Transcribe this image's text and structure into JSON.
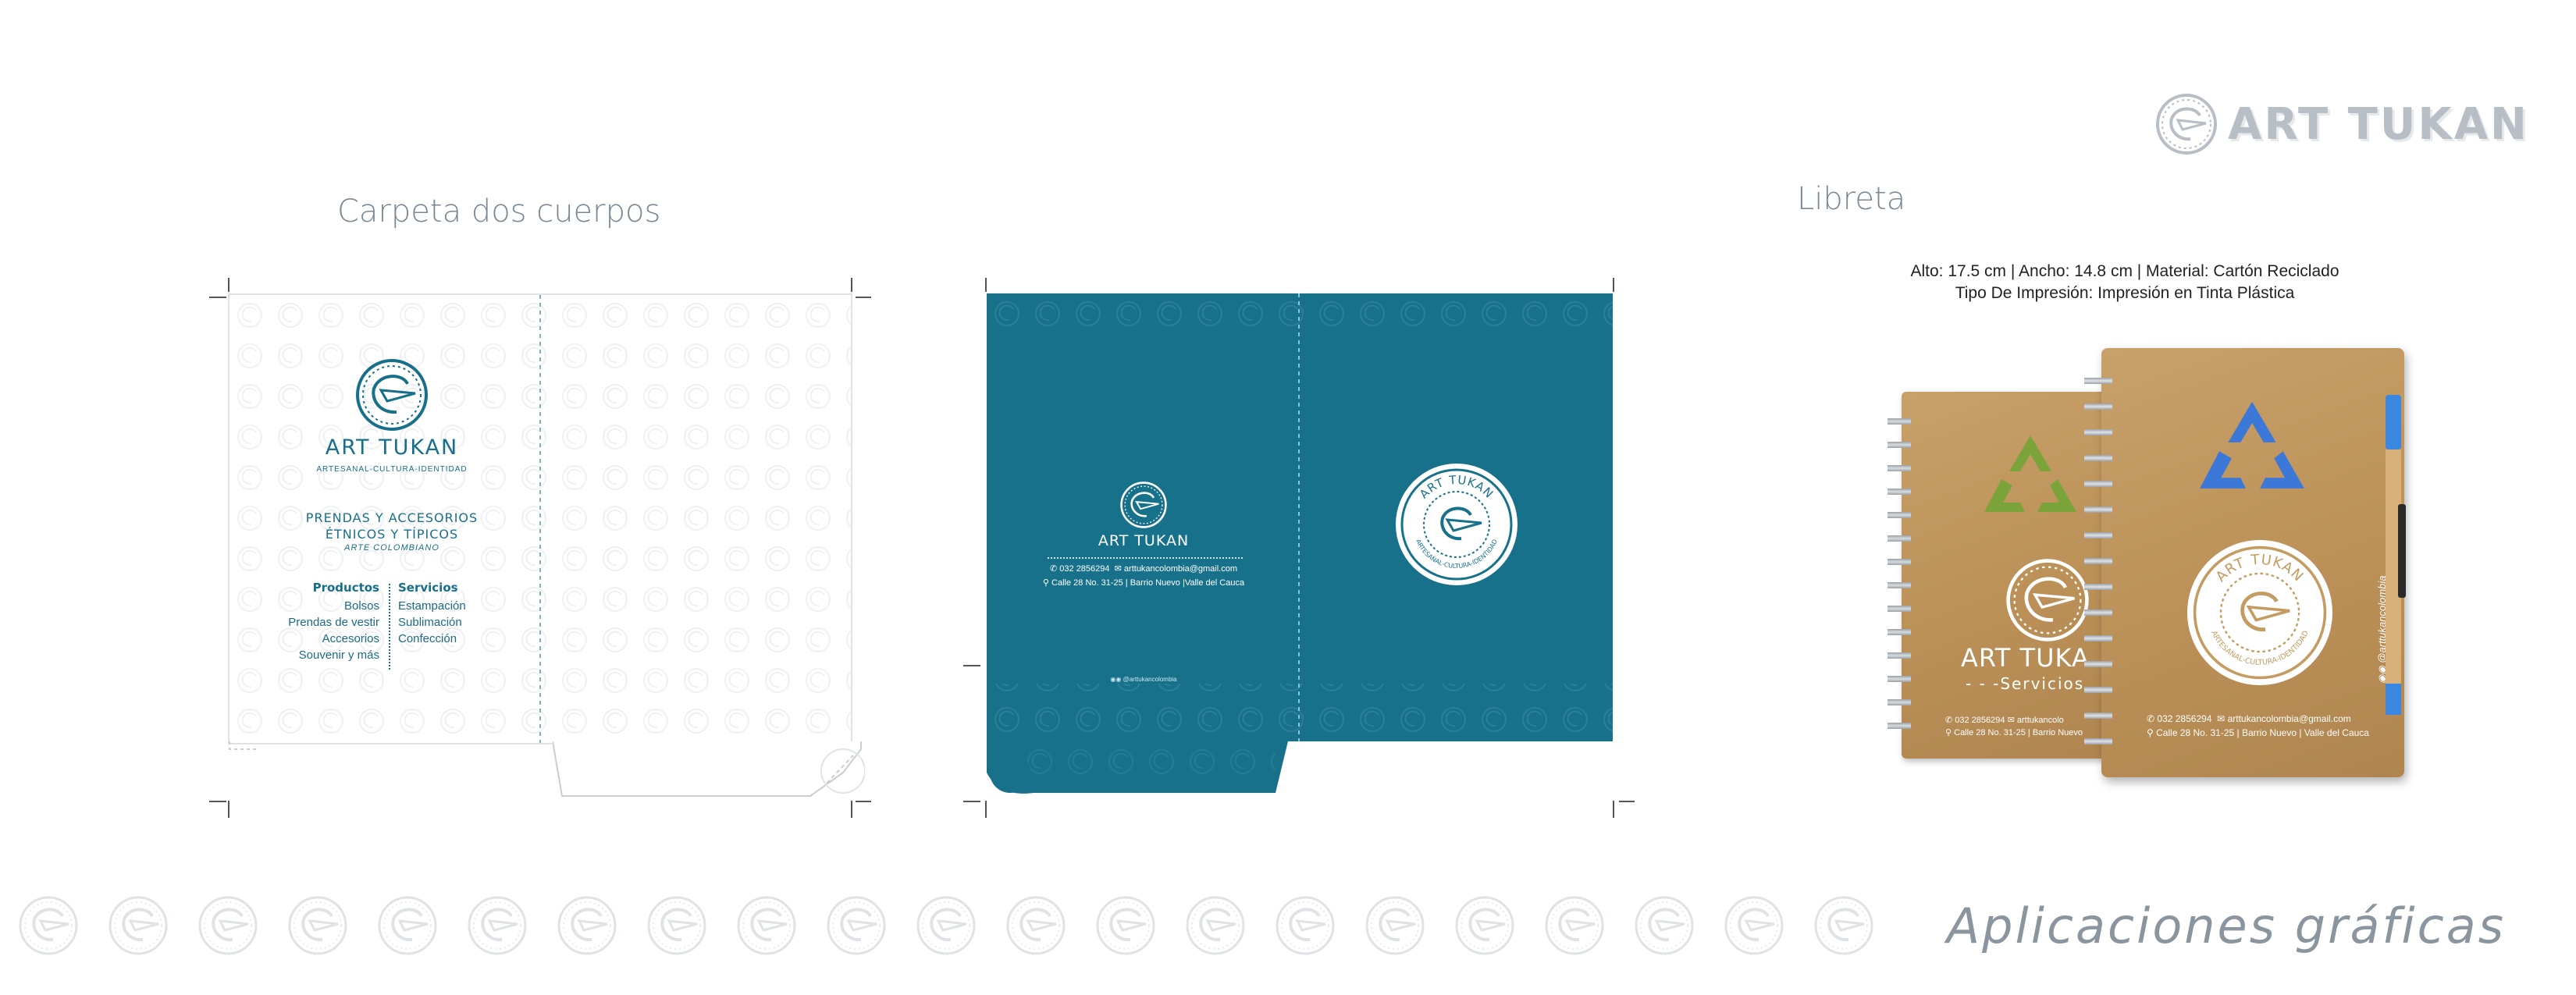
{
  "header": {
    "brand_logo_text": "ART TUKAN"
  },
  "sections": {
    "carpeta_title": "Carpeta dos cuerpos",
    "libreta_title": "Libreta"
  },
  "folder_front": {
    "brand_name": "ART TUKAN",
    "tagline": "ARTESANAL-CULTURA-IDENTIDAD",
    "headline_line1": "PRENDAS Y ACCESORIOS",
    "headline_line2": "ÉTNICOS Y TÍPICOS",
    "subheadline": "ARTE COLOMBIANO",
    "products_title": "Productos",
    "products": [
      "Bolsos",
      "Prendas de vestir",
      "Accesorios",
      "Souvenir y más"
    ],
    "services_title": "Servicios",
    "services": [
      "Estampación",
      "Sublimación",
      "Confección"
    ]
  },
  "folder_back": {
    "brand_name": "ART TUKAN",
    "phone": "032 2856294",
    "email": "arttukancolombia@gmail.com",
    "address": "Calle 28 No. 31-25 | Barrio Nuevo |Valle del Cauca",
    "social": "@arttukancolombia",
    "seal_top": "ART TUKAN",
    "seal_bottom": "ARTESANAL-CULTURA-IDENTIDAD"
  },
  "libreta": {
    "specs_line1": "Alto: 17.5 cm  |  Ancho: 14.8 cm  |   Material: Cartón Reciclado",
    "specs_line2": "Tipo De Impresión: Impresión en Tinta Plástica",
    "back_brand": "ART TUKA",
    "back_sub": "- - -Servicios",
    "back_phone": "032 2856294",
    "back_email": "arttukancolo",
    "back_address": "Calle 28 No. 31-25 | Barrio Nuevo",
    "front_seal_top": "ART TUKAN",
    "front_seal_bottom": "ARTESANAL-CULTURA-IDENTIDAD",
    "front_phone": "032 2856294",
    "front_email": "arttukancolombia@gmail.com",
    "front_address": "Calle 28 No. 31-25 | Barrio Nuevo | Valle del Cauca",
    "front_social": "@arttukancolombia"
  },
  "footer": {
    "title": "Aplicaciones gráficas"
  },
  "colors": {
    "brand_teal": "#17718b",
    "kraft": "#c49b61",
    "recycle_green": "#7aa33a",
    "recycle_blue": "#3c78d8"
  }
}
